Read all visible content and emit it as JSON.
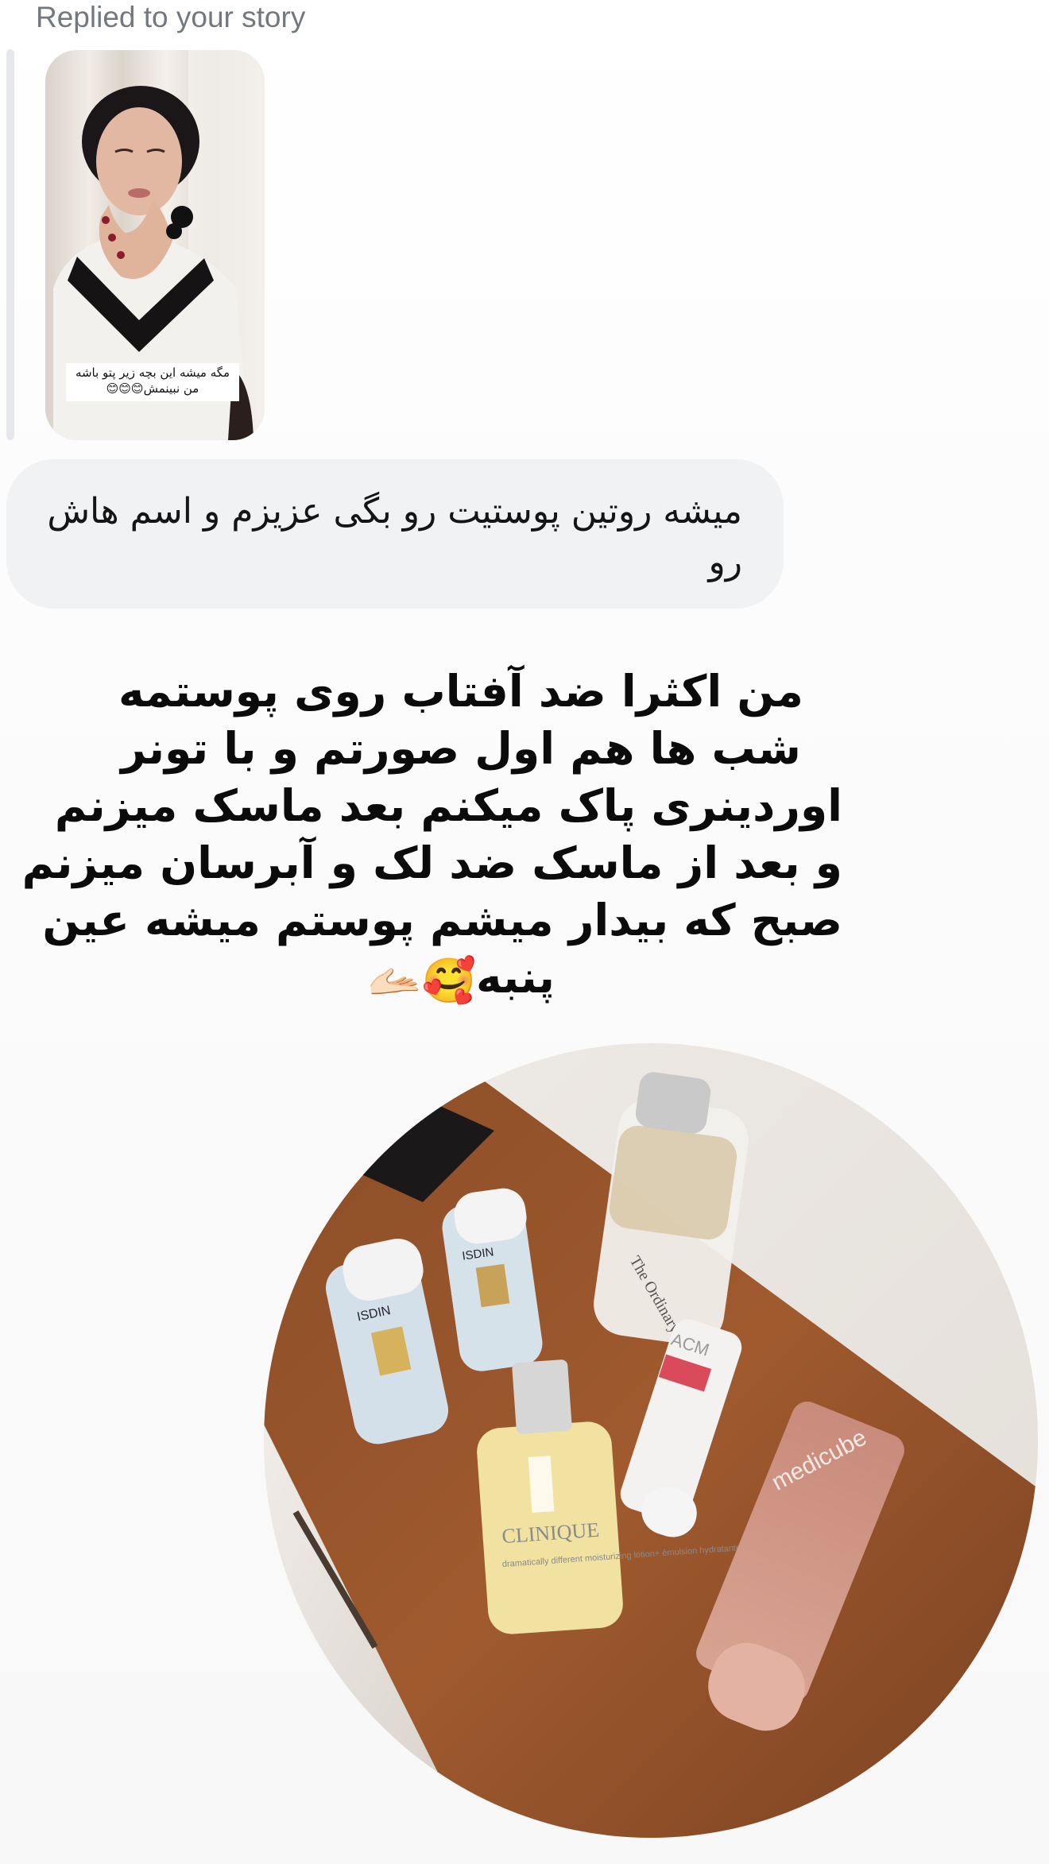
{
  "story_reply": {
    "label": "Replied to your story",
    "story_caption": "مگه میشه این بچه زیر پتو باشه من نبینمش😊😊😊"
  },
  "message": {
    "text": "میشه روتین پوستیت رو بگی عزیزم و اسم هاش رو"
  },
  "reply_story": {
    "lines": [
      "من اکثرا ضد آفتاب روی پوستمه",
      "شب ها هم اول صورتم و با تونر",
      "اوردینری پاک میکنم بعد ماسک میزنم",
      "و بعد از ماسک ضد لک و آبرسان میزنم",
      "صبح که بیدار میشم پوستم میشه عین",
      "پنبه"
    ],
    "emoji": "🫴🏻🥰"
  },
  "products": {
    "labels": {
      "ordinary": "The Ordinary",
      "isdin_1": "ISDIN",
      "isdin_2": "ISDIN",
      "acm": "ACM",
      "clinique": "CLINIQUE",
      "clinique_sub": "dramatically different moisturizing lotion+ émulsion hydratante tellement différente",
      "medicube": "medicube"
    }
  }
}
